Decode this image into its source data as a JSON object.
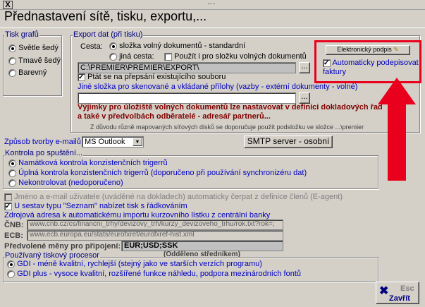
{
  "window": {
    "close_label": "X",
    "title": "Přednastavení sítě, tisku, exportu,..."
  },
  "print_graphs": {
    "legend": "Tisk grafů",
    "options": [
      "Světle šedý",
      "Tmavě šedý",
      "Barevný"
    ],
    "selected": 0
  },
  "export": {
    "legend": "Export dat (při tisku)",
    "path_label": "Cesta:",
    "opt_free_docs": "složka volný dokumentů - standardní",
    "opt_other": "jiná cesta:",
    "use_for_free_docs": "Použít i pro složku volných dokumentů",
    "path_value": "C:\\PREMIER\\PREMIER\\EXPORT\\",
    "browse_label": "...",
    "ask_overwrite": "Ptát se na přepsání existujícího souboru",
    "scan_label": "Jiné složka pro skenované a vkládané přílohy (vazby - extérní dokumenty - volné)",
    "scan_value": "",
    "scan_browse": "...",
    "warn1": "Výjimky pro úložiště volných dokumentů lze nastavovat v definici dokladových řad",
    "warn2": "a také v předvolbách odběratelé - adresář partnerů...",
    "note": "Z důvodu různě mapovaných síťových disků se doporučuje použít podsložku ve složce ...\\premier"
  },
  "signature": {
    "button_label": "Elektronický podpis",
    "auto_sign": "Automaticky podepisovat faktury"
  },
  "email": {
    "label": "Způsob tvorby e-mailů",
    "selected": "MS Outlook",
    "smtp_button": "SMTP server - osobní"
  },
  "startup_check": {
    "legend": "Kontrola po spuštění...",
    "options": [
      "Namátková kontrola konzistenčních trigerrů",
      "Úplná kontrola konzistenčních trigerrů (doporučeno při používání synchronizéru dat)",
      "Nekontrolovat (nedoporučeno)"
    ],
    "selected": 0
  },
  "user_options": {
    "name_email": "Jméno a e-mail uživatele (uváděné na dokladech) automaticky čerpat z definice členů (E-agent)",
    "list_print": "U sestav typu \"Seznam\" nabízet tisk s řádkováním"
  },
  "rates": {
    "legend": "Zdrojová adresa k automatickému importu kurzovního lístku z centrální banky",
    "cnb_label": "ČNB:",
    "cnb_value": "www.cnb.cz/cs/financni_trhy/devizovy_trh/kurzy_devizoveho_trhu/rok.txt?rok=;",
    "ecb_label": "ECB:",
    "ecb_value": "www.ecb.europa.eu/stats/eurofxref/eurofxref-hist.xml",
    "currencies_label": "Předvolené měny pro připojení:",
    "currencies_value": "EUR;USD;SSK",
    "currencies_note": "(Odděleno středníkem)"
  },
  "print_processor": {
    "legend": "Používaný tiskový procesor",
    "options": [
      "GDI - méně kvalitní, rychlejší (stejný jako ve starších verzích programu)",
      "GDI plus - vysoce kvalitní, rozšířené funkce náhledu, podpora mezinárodních fontů"
    ],
    "selected": 0
  },
  "close_button": {
    "esc_label": "Esc",
    "label": "Zavřít"
  },
  "colors": {
    "annotation_red": "#e8001c",
    "legend_blue": "#00007f",
    "warning_darkred": "#800000"
  }
}
